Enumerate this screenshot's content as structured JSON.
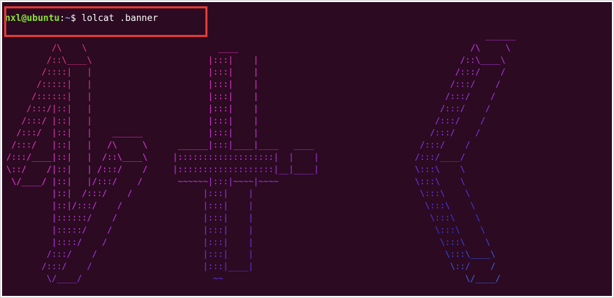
{
  "prompt": {
    "user_host": "nxl@ubuntu",
    "separator": ":",
    "path": "~",
    "symbol": "$",
    "command": "lolcat .banner"
  },
  "banner_lines": [
    "                                                                                               ______",
    "         /\\    \\                          ____                                              /\\     \\",
    "        /::\\____\\                       |:::|    |                                        /::\\____\\",
    "       /::::|   |                       |:::|    |                                       /:::/    /",
    "      /:::::|   |                       |:::|    |                                      /:::/    /",
    "     /::::::|   |                       |:::|    |                                     /:::/    /",
    "    /:::/|::|   |                       |:::|    |                                    /:::/    /",
    "   /:::/ |::|   |                       |:::|    |                                   /:::/    /",
    "  /:::/  |::|   |    ______             |:::|    |                                  /:::/    /",
    " /:::/   |::|   |   /\\     \\      ______|:::|____|____   ____                     /:::/    /",
    "/:::/____|::|   |  /::\\____\\     |:::::::::::::::::::|  |    |                   /:::/____/",
    "\\::/    /|::|   | /:::/    /     |:::::::::::::::::::|__|____|                   \\:::\\    \\",
    " \\/____/ |::|   |/:::/    /       ~~~~~~|:::|~~~~|~~~~                           \\:::\\    \\",
    "         |::|  /:::/    /              |:::|    |                                 \\:::\\    \\",
    "         |::|/:::/    /                |:::|    |                                  \\:::\\    \\",
    "         |::::::/    /                 |:::|    |                                   \\:::\\    \\",
    "         |:::::/    /                  |:::|    |                                    \\:::\\    \\",
    "         |::::/    /                   |:::|    |                                     \\:::\\    \\",
    "        /:::/    /                     |:::|    |                                      \\:::\\____\\",
    "       /:::/    /                      |:::|____|                                       \\::/    /",
    "        \\/____/                          ~~                                                \\/____/"
  ],
  "colors": {
    "background": "#2c0a22",
    "user_host": "#8ae234",
    "path": "#729fcf",
    "highlight_border": "#e53935"
  }
}
